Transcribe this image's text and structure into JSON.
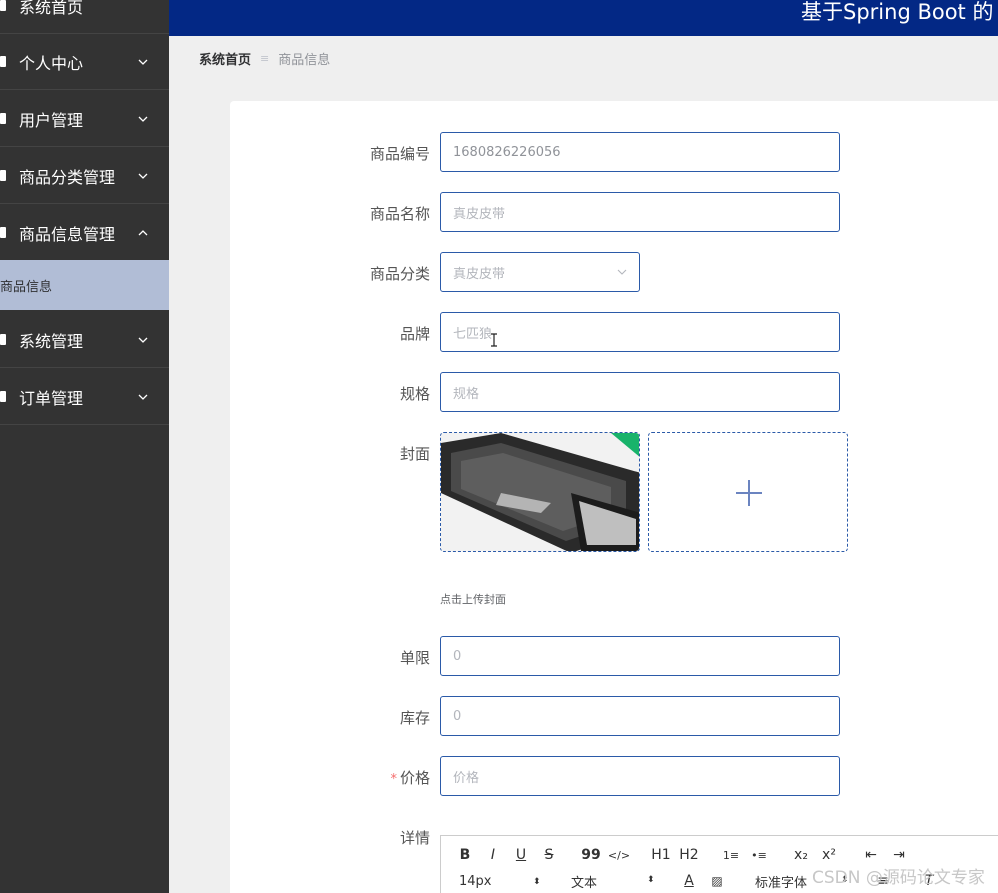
{
  "header": {
    "title": "基于Spring Boot 的"
  },
  "sidebar": {
    "items": [
      {
        "label": "系统首页"
      },
      {
        "label": "个人中心"
      },
      {
        "label": "用户管理"
      },
      {
        "label": "商品分类管理"
      },
      {
        "label": "商品信息管理"
      },
      {
        "label": "系统管理"
      },
      {
        "label": "订单管理"
      }
    ],
    "submenu": {
      "label": "商品信息"
    }
  },
  "breadcrumb": {
    "home": "系统首页",
    "separator": "≡",
    "current": "商品信息"
  },
  "form": {
    "code": {
      "label": "商品编号",
      "value": "1680826226056"
    },
    "name": {
      "label": "商品名称",
      "value": "真皮皮带"
    },
    "category": {
      "label": "商品分类",
      "value": "真皮皮带"
    },
    "brand": {
      "label": "品牌",
      "value": "七匹狼"
    },
    "spec": {
      "label": "规格",
      "placeholder": "规格"
    },
    "cover": {
      "label": "封面",
      "tip": "点击上传封面",
      "add_symbol": "+"
    },
    "limit": {
      "label": "单限",
      "value": "0"
    },
    "stock": {
      "label": "库存",
      "value": "0"
    },
    "price": {
      "label": "价格",
      "required": "*",
      "placeholder": "价格"
    },
    "detail": {
      "label": "详情"
    }
  },
  "editor": {
    "toolbar_row1": [
      "B",
      "I",
      "U",
      "S",
      "99",
      "</>",
      "H1",
      "H2",
      "1≡",
      "•≡",
      "x₂",
      "x²",
      "⇤",
      "⇥"
    ],
    "font_size": "14px",
    "block_type": "文本",
    "font_family": "标准字体"
  },
  "watermark": "CSDN @源码论文专家",
  "colors": {
    "sidebar_bg": "#333333",
    "header_bg": "#032885",
    "active_submenu": "#b1bdd6",
    "input_border": "#2b5aa8"
  }
}
